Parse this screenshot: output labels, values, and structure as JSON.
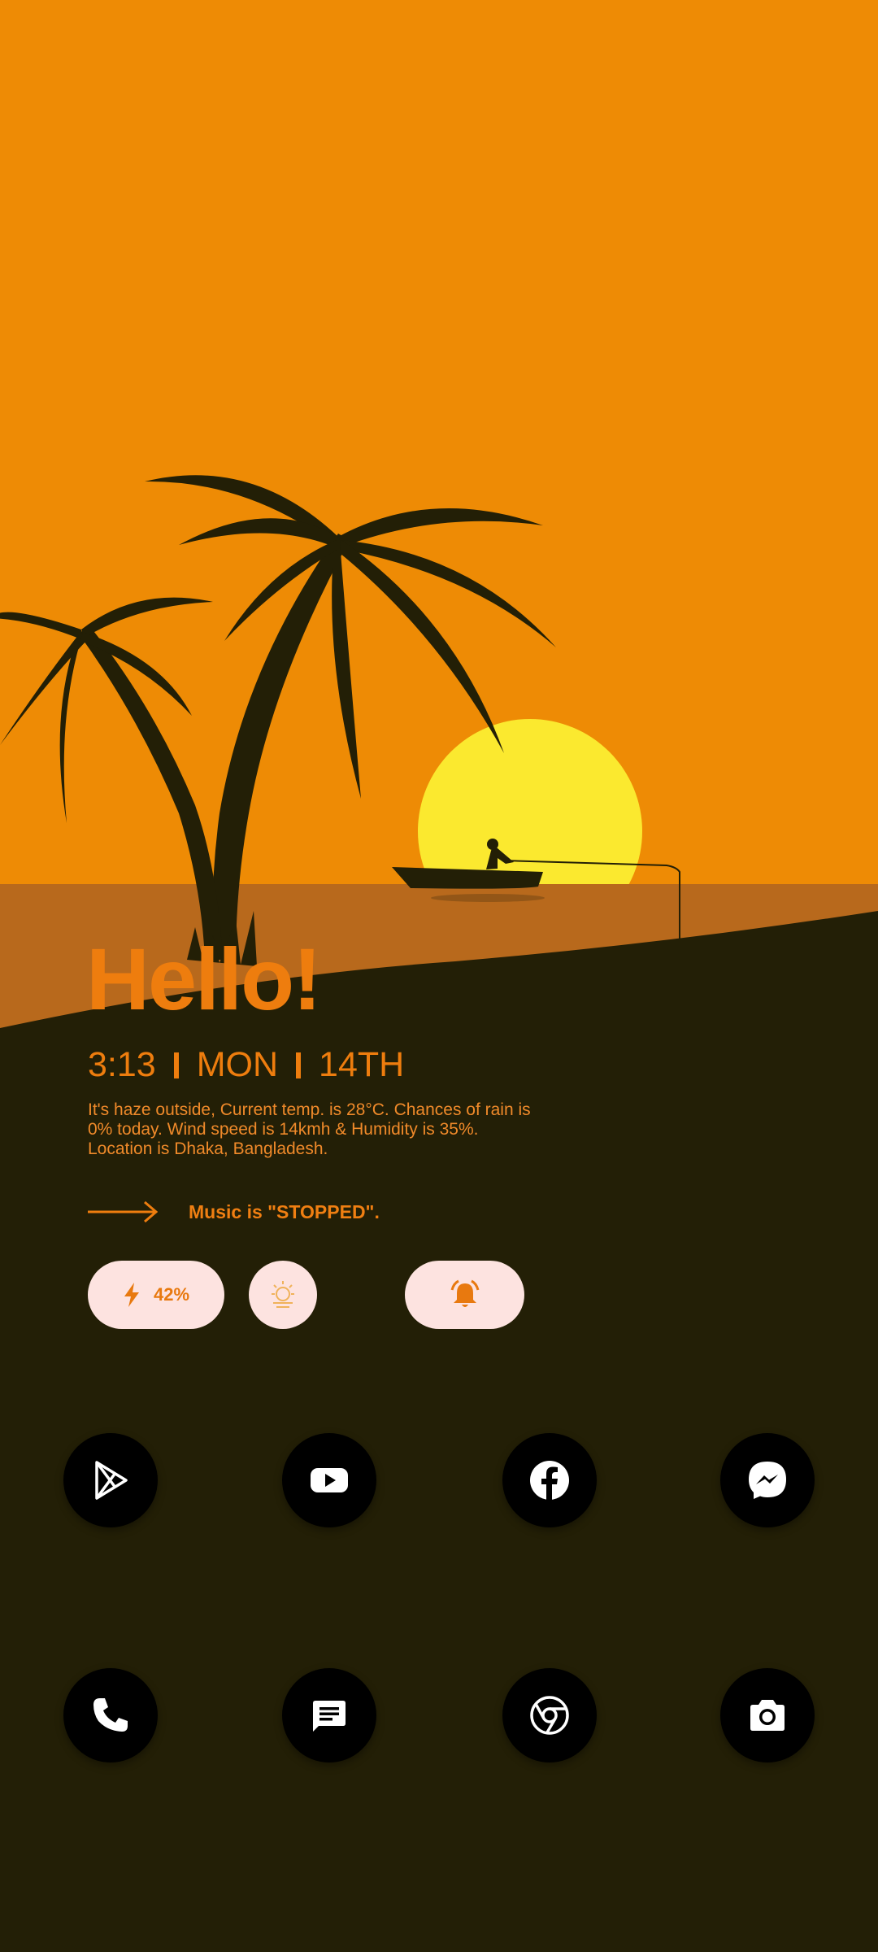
{
  "greeting": "Hello!",
  "clock": {
    "time": "3:13",
    "day": "MON",
    "date": "14TH"
  },
  "weather_text": "It's haze outside, Current temp. is 28°C. Chances of rain is 0% today. Wind speed is 14kmh & Humidity is 35%. Location is Dhaka, Bangladesh.",
  "music": {
    "prefix": "Music is ",
    "status": "\"STOPPED\"."
  },
  "widgets": {
    "battery": "42%"
  },
  "apps": [
    {
      "name": "Play Store",
      "icon": "play-store-icon"
    },
    {
      "name": "YouTube",
      "icon": "youtube-icon"
    },
    {
      "name": "Facebook",
      "icon": "facebook-icon"
    },
    {
      "name": "Messenger",
      "icon": "messenger-icon"
    },
    {
      "name": "Phone",
      "icon": "phone-icon"
    },
    {
      "name": "Messages",
      "icon": "messages-icon"
    },
    {
      "name": "Chrome",
      "icon": "chrome-icon"
    },
    {
      "name": "Camera",
      "icon": "camera-icon"
    }
  ],
  "colors": {
    "sky": "#ee8b05",
    "sun": "#fbe92f",
    "water": "#b8691c",
    "ground": "#231f06",
    "accent": "#ee7d0e",
    "pill": "#fde3e0"
  }
}
